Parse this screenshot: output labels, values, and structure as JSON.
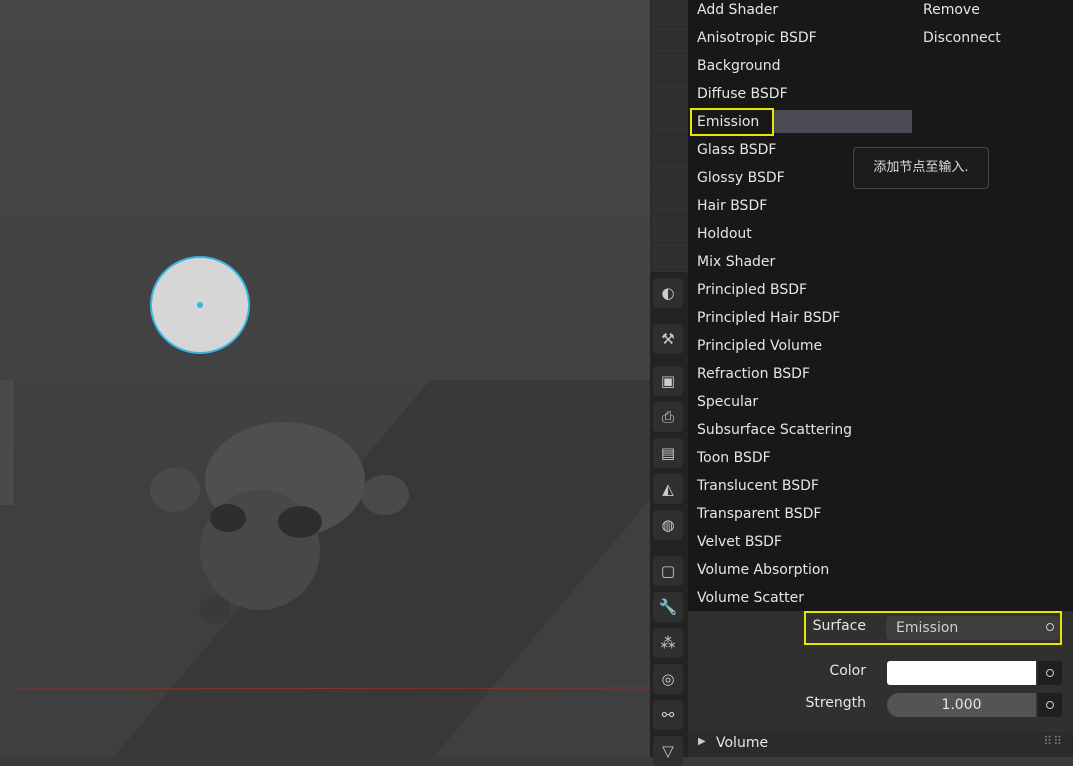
{
  "shader_menu": {
    "items": [
      {
        "label": "Add Shader"
      },
      {
        "label": "Anisotropic BSDF"
      },
      {
        "label": "Background"
      },
      {
        "label": "Diffuse BSDF"
      },
      {
        "label": "Emission"
      },
      {
        "label": "Glass BSDF"
      },
      {
        "label": "Glossy BSDF"
      },
      {
        "label": "Hair BSDF"
      },
      {
        "label": "Holdout"
      },
      {
        "label": "Mix Shader"
      },
      {
        "label": "Principled BSDF"
      },
      {
        "label": "Principled Hair BSDF"
      },
      {
        "label": "Principled Volume"
      },
      {
        "label": "Refraction BSDF"
      },
      {
        "label": "Specular"
      },
      {
        "label": "Subsurface Scattering"
      },
      {
        "label": "Toon BSDF"
      },
      {
        "label": "Translucent BSDF"
      },
      {
        "label": "Transparent BSDF"
      },
      {
        "label": "Velvet BSDF"
      },
      {
        "label": "Volume Absorption"
      },
      {
        "label": "Volume Scatter"
      }
    ],
    "right_items": [
      {
        "label": "Remove"
      },
      {
        "label": "Disconnect"
      }
    ],
    "highlighted": "Emission"
  },
  "tooltip": {
    "text": "添加节点至输入."
  },
  "surface": {
    "label": "Surface",
    "value": "Emission"
  },
  "color": {
    "label": "Color",
    "value": "#ffffff"
  },
  "strength": {
    "label": "Strength",
    "value": "1.000"
  },
  "volume": {
    "label": "Volume"
  },
  "accent_colors": {
    "highlight": "#e6e600",
    "light_selected": "#39b4e6"
  }
}
